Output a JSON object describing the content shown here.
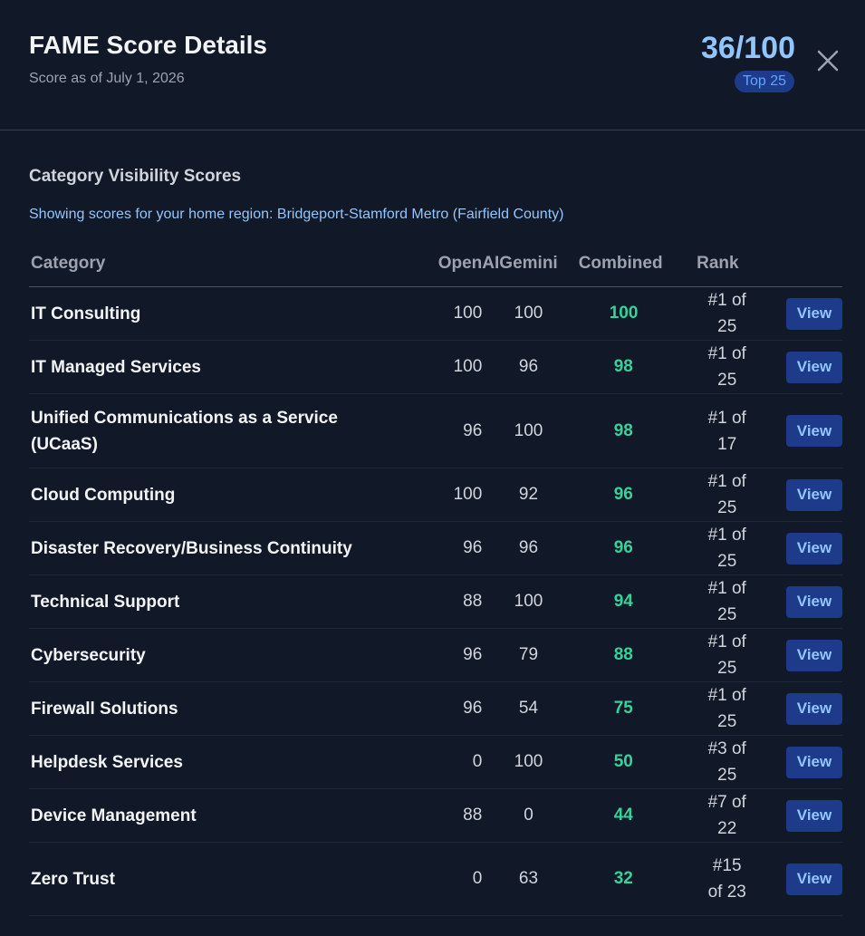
{
  "header": {
    "title": "FAME Score Details",
    "subtitle": "Score as of July 1, 2026",
    "score": "36/100",
    "badge": "Top 25"
  },
  "section": {
    "title": "Category Visibility Scores",
    "region_note": "Showing scores for your home region: Bridgeport-Stamford Metro (Fairfield County)"
  },
  "table": {
    "columns": [
      "Category",
      "OpenAI",
      "Gemini",
      "Combined",
      "Rank"
    ],
    "rows": [
      {
        "category": "IT Consulting",
        "openai": "100",
        "gemini": "100",
        "combined": "100",
        "rank": "#1 of 25",
        "action": "View"
      },
      {
        "category": "IT Managed Services",
        "openai": "100",
        "gemini": "96",
        "combined": "98",
        "rank": "#1 of 25",
        "action": "View"
      },
      {
        "category": "Unified Communications as a Service (UCaaS)",
        "openai": "96",
        "gemini": "100",
        "combined": "98",
        "rank": "#1 of 17",
        "action": "View"
      },
      {
        "category": "Cloud Computing",
        "openai": "100",
        "gemini": "92",
        "combined": "96",
        "rank": "#1 of 25",
        "action": "View"
      },
      {
        "category": "Disaster Recovery/Business Continuity",
        "openai": "96",
        "gemini": "96",
        "combined": "96",
        "rank": "#1 of 25",
        "action": "View"
      },
      {
        "category": "Technical Support",
        "openai": "88",
        "gemini": "100",
        "combined": "94",
        "rank": "#1 of 25",
        "action": "View"
      },
      {
        "category": "Cybersecurity",
        "openai": "96",
        "gemini": "79",
        "combined": "88",
        "rank": "#1 of 25",
        "action": "View"
      },
      {
        "category": "Firewall Solutions",
        "openai": "96",
        "gemini": "54",
        "combined": "75",
        "rank": "#1 of 25",
        "action": "View"
      },
      {
        "category": "Helpdesk Services",
        "openai": "0",
        "gemini": "100",
        "combined": "50",
        "rank": "#3 of 25",
        "action": "View"
      },
      {
        "category": "Device Management",
        "openai": "88",
        "gemini": "0",
        "combined": "44",
        "rank": "#7 of 22",
        "action": "View"
      },
      {
        "category": "Zero Trust",
        "openai": "0",
        "gemini": "63",
        "combined": "32",
        "rank": "#15 of 23",
        "action": "View"
      }
    ]
  },
  "colors": {
    "background": "#111827",
    "accent": "#93c5fd",
    "combined": "#34d399",
    "button_bg": "#1e3a8a"
  },
  "icons": {
    "close": "close-icon"
  }
}
